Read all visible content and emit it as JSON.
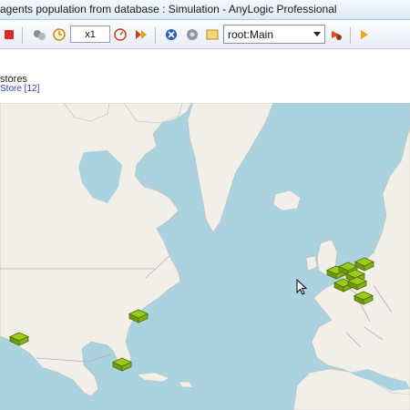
{
  "window": {
    "title": "agents population from database : Simulation - AnyLogic Professional"
  },
  "toolbar": {
    "icons": [
      "stop-icon",
      "step-icon",
      "clock-icon",
      "speed-icon",
      "run-until-icon",
      "breakpoint-icon",
      "experiment-icon",
      "camera-icon",
      "navigate-icon",
      "forward-icon"
    ],
    "speed_value": "x1",
    "navigator_value": "root:Main"
  },
  "canvas": {
    "stores_label": "stores",
    "store_population_label": "Store [12]"
  },
  "map": {
    "marker_color": "#9ccc1a",
    "marker_count": 10
  },
  "colors": {
    "ocean": "#aad3df",
    "land": "#f2efe9",
    "border": "#c9a2c0"
  }
}
